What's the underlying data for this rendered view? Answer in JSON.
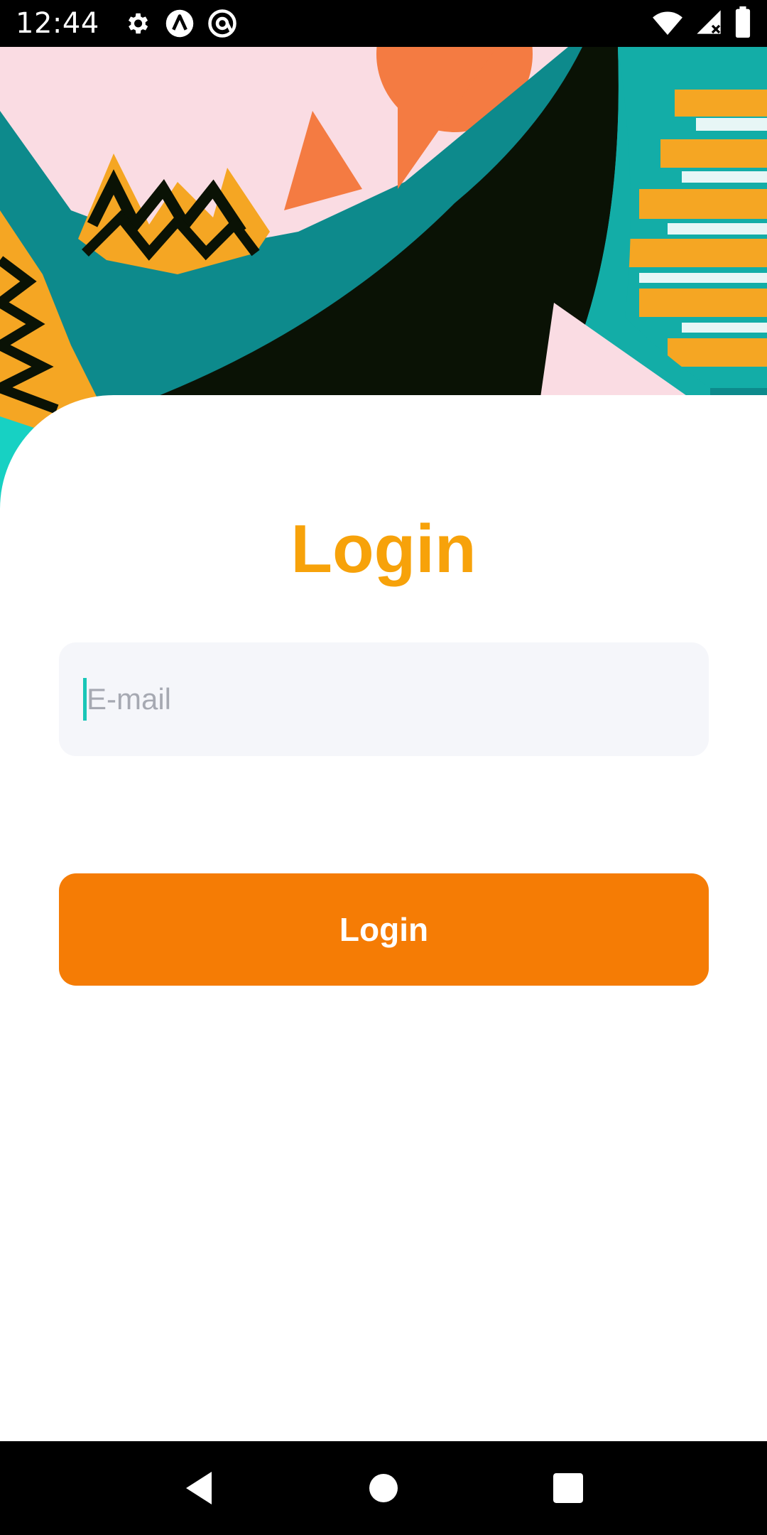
{
  "status_bar": {
    "time": "12:44",
    "left_icons": [
      "settings-gear-icon",
      "app-a-icon",
      "app-at-icon"
    ],
    "right_icons": [
      "wifi-icon",
      "signal-icon",
      "battery-icon"
    ]
  },
  "login": {
    "title": "Login",
    "email_placeholder": "E-mail",
    "email_value": "",
    "button_label": "Login"
  },
  "nav_bar": {
    "buttons": [
      "back-icon",
      "home-icon",
      "recents-icon"
    ]
  },
  "colors": {
    "title": "#F7A20A",
    "button": "#F57C05",
    "field_bg": "#F5F6FA",
    "caret": "#19C6B7",
    "hero_pink": "#FADCE3",
    "hero_teal": "#0D8A8C",
    "hero_dark": "#0A1205",
    "hero_orange": "#F47B42",
    "hero_yellow": "#F5A623"
  }
}
